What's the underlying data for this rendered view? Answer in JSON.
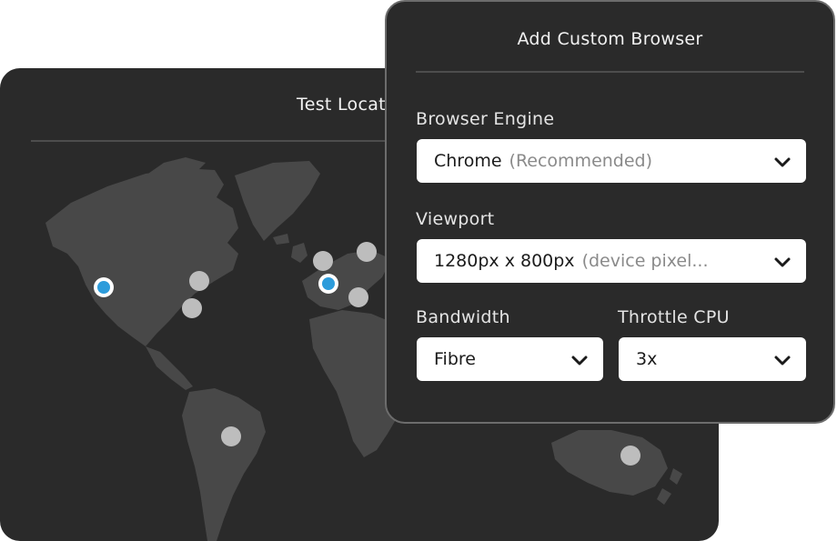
{
  "locations_card": {
    "title": "Test Locations"
  },
  "dialog": {
    "title": "Add Custom Browser",
    "browser_engine": {
      "label": "Browser Engine",
      "value": "Chrome",
      "hint": "(Recommended)"
    },
    "viewport": {
      "label": "Viewport",
      "value": "1280px x 800px",
      "hint": "(device pixel..."
    },
    "bandwidth": {
      "label": "Bandwidth",
      "value": "Fibre"
    },
    "throttle_cpu": {
      "label": "Throttle CPU",
      "value": "3x"
    }
  },
  "colors": {
    "card_bg": "#2a2a2a",
    "land": "#484848",
    "marker_active": "#2d9cdb",
    "marker_inactive": "#bdbdbd"
  },
  "icons": [
    "chevron-down-icon",
    "location-marker-icon"
  ]
}
